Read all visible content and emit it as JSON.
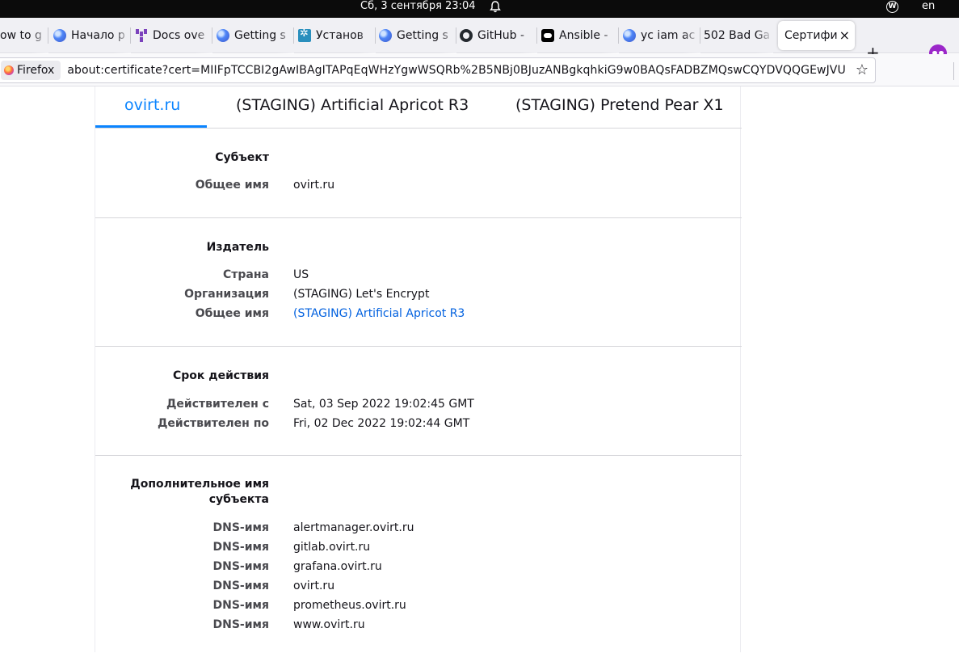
{
  "system_bar": {
    "clock": "Сб, 3 сентября  23:04",
    "language": "en"
  },
  "browser": {
    "tabs": [
      {
        "label": "ow to g",
        "icon": "page-icon"
      },
      {
        "label": "Начало р",
        "icon": "blue-globe-icon"
      },
      {
        "label": "Docs ove",
        "icon": "terraform-icon"
      },
      {
        "label": "Getting s",
        "icon": "blue-globe-icon"
      },
      {
        "label": "Установ",
        "icon": "install-icon"
      },
      {
        "label": "Getting s",
        "icon": "blue-globe-icon"
      },
      {
        "label": "GitHub -",
        "icon": "github-icon"
      },
      {
        "label": "Ansible -",
        "icon": "ansible-icon"
      },
      {
        "label": "yc iam ac",
        "icon": "blue-globe-icon"
      },
      {
        "label": "502 Bad Ga",
        "icon": "none"
      },
      {
        "label": "Сертифи",
        "icon": "none",
        "active": true
      }
    ],
    "identity_label": "Firefox",
    "url": "about:certificate?cert=MIIFpTCCBI2gAwIBAgITAPqEqWHzYgwWSQRb%2B5NBj0BJuzANBgkqhkiG9w0BAQsFADBZMQswCQYDVQQGEwJVU"
  },
  "certificate": {
    "tabs": [
      "ovirt.ru",
      "(STAGING) Artificial Apricot R3",
      "(STAGING) Pretend Pear X1"
    ],
    "subject": {
      "title": "Субъект",
      "common_name_label": "Общее имя",
      "common_name": "ovirt.ru"
    },
    "issuer": {
      "title": "Издатель",
      "country_label": "Страна",
      "country": "US",
      "org_label": "Организация",
      "org": "(STAGING) Let's Encrypt",
      "common_name_label": "Общее имя",
      "common_name": "(STAGING) Artificial Apricot R3"
    },
    "validity": {
      "title": "Срок действия",
      "not_before_label": "Действителен с",
      "not_before": "Sat, 03 Sep 2022 19:02:45 GMT",
      "not_after_label": "Действителен по",
      "not_after": "Fri, 02 Dec 2022 19:02:44 GMT"
    },
    "san": {
      "title_line1": "Дополнительное имя",
      "title_line2": "субъекта",
      "dns_label": "DNS-имя",
      "names": [
        "alertmanager.ovirt.ru",
        "gitlab.ovirt.ru",
        "grafana.ovirt.ru",
        "ovirt.ru",
        "prometheus.ovirt.ru",
        "www.ovirt.ru"
      ]
    }
  },
  "colors": {
    "accent": "#0a84ff",
    "link": "#0060df"
  }
}
